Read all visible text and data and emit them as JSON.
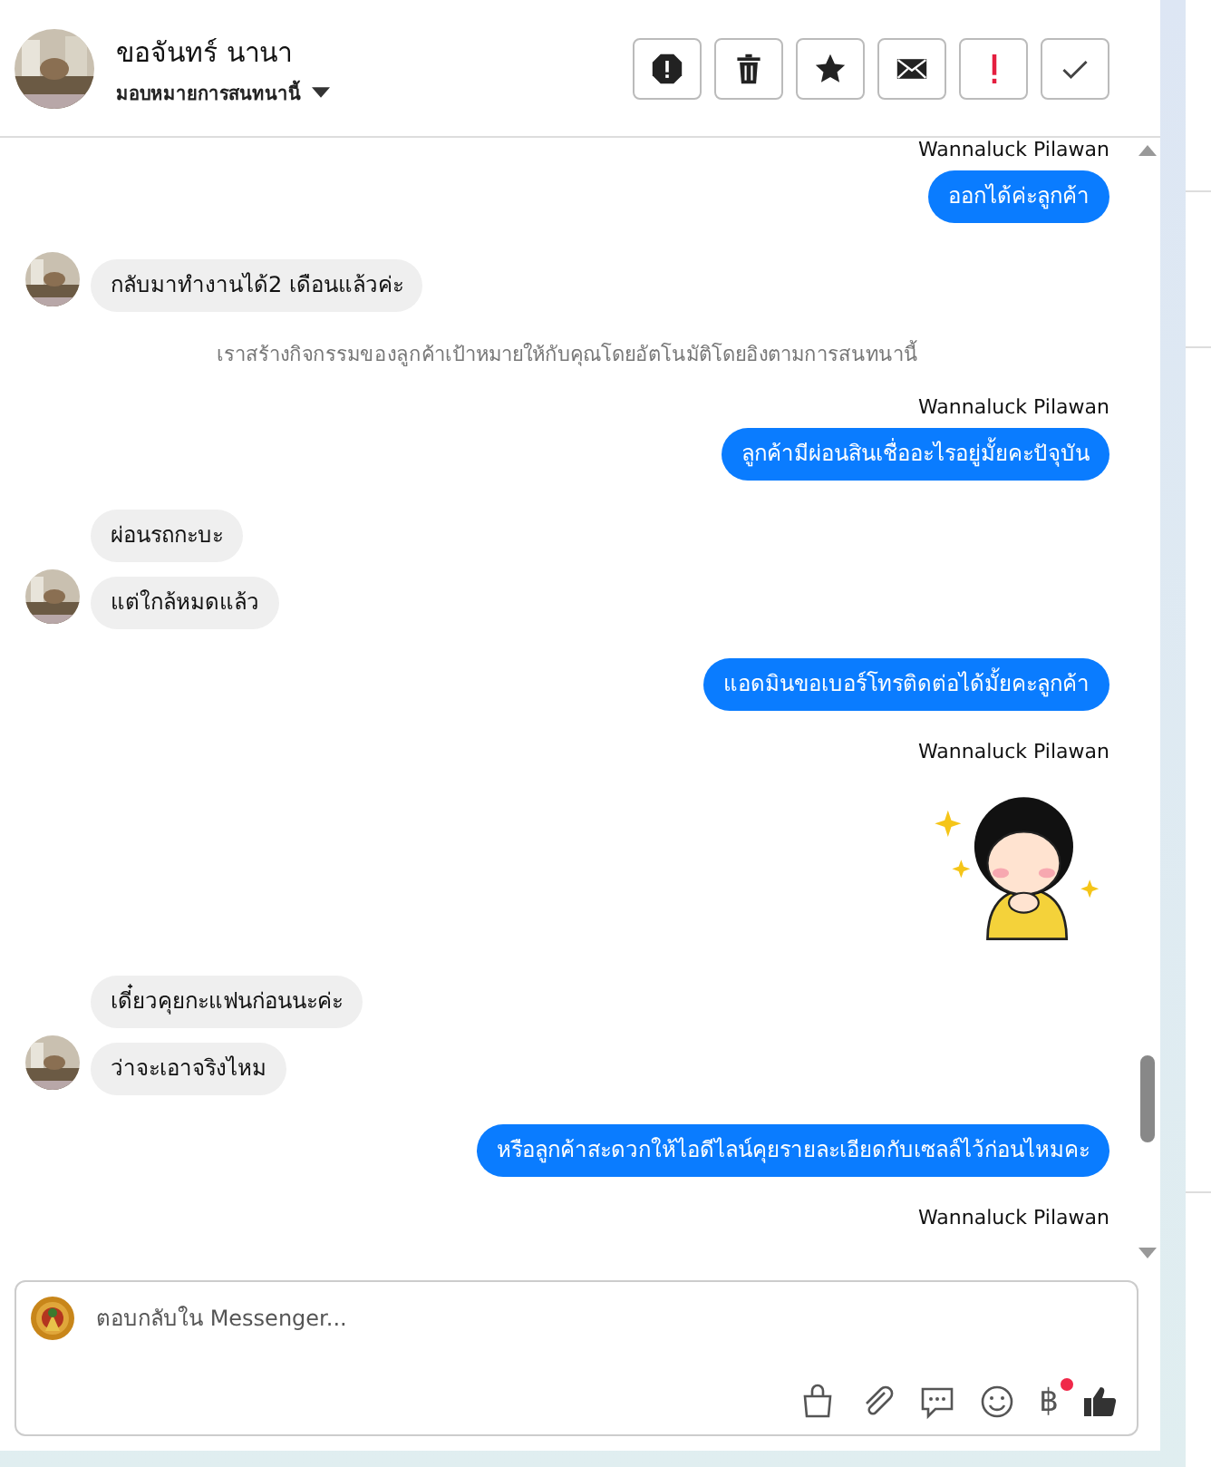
{
  "header": {
    "name": "ขอจันทร์ นานา",
    "subtitle": "มอบหมายการสนทนานี้",
    "actions": [
      {
        "kind": "report"
      },
      {
        "kind": "delete"
      },
      {
        "kind": "star"
      },
      {
        "kind": "mail"
      },
      {
        "kind": "alert"
      },
      {
        "kind": "done"
      }
    ]
  },
  "messages": [
    {
      "kind": "sender",
      "text": "Wannaluck Pilawan"
    },
    {
      "kind": "outgoing",
      "text": "ออกได้ค่ะลูกค้า"
    },
    {
      "kind": "incoming",
      "text": "กลับมาทำงานได้2 เดือนแล้วค่ะ",
      "avatar": true
    },
    {
      "kind": "system",
      "text": "เราสร้างกิจกรรมของลูกค้าเป้าหมายให้กับคุณโดยอัตโนมัติโดยอิงตามการสนทนานี้"
    },
    {
      "kind": "sender",
      "text": "Wannaluck Pilawan"
    },
    {
      "kind": "outgoing",
      "text": "ลูกค้ามีผ่อนสินเชื่ออะไรอยู่มั้ยคะปัจุบัน"
    },
    {
      "kind": "incoming",
      "text": "ผ่อนรถกะบะ",
      "avatar": false
    },
    {
      "kind": "incoming",
      "text": "แต่ใกล้หมดแล้ว",
      "avatar": true
    },
    {
      "kind": "outgoing",
      "text": "แอดมินขอเบอร์โทรติดต่อได้มั้ยคะลูกค้า"
    },
    {
      "kind": "sender",
      "text": "Wannaluck Pilawan"
    },
    {
      "kind": "sticker"
    },
    {
      "kind": "incoming",
      "text": "เดี๋ยวคุยกะแฟนก่อนนะค่ะ",
      "avatar": false
    },
    {
      "kind": "incoming",
      "text": "ว่าจะเอาจริงไหม",
      "avatar": true
    },
    {
      "kind": "outgoing",
      "text": "หรือลูกค้าสะดวกให้ไอดีไลน์คุยรายละเอียดกับเซลล์ไว้ก่อนไหมคะ"
    },
    {
      "kind": "sender",
      "text": "Wannaluck Pilawan"
    }
  ],
  "composer": {
    "placeholder": "ตอบกลับใน Messenger...",
    "currency": "฿",
    "notification": true
  }
}
